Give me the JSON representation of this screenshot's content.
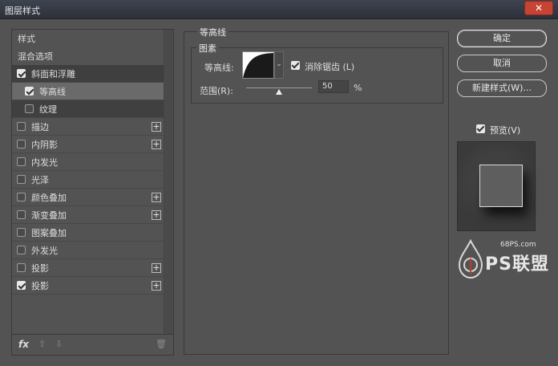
{
  "window": {
    "title": "图层样式",
    "close_glyph": "✕"
  },
  "styles_list": {
    "items": [
      {
        "label": "样式",
        "checkbox": false,
        "checked": false,
        "plus": false
      },
      {
        "label": "混合选项",
        "checkbox": false,
        "checked": false,
        "plus": false
      },
      {
        "label": "斜面和浮雕",
        "checkbox": true,
        "checked": true,
        "plus": false
      },
      {
        "label": "等高线",
        "checkbox": true,
        "checked": true,
        "plus": false
      },
      {
        "label": "纹理",
        "checkbox": true,
        "checked": false,
        "plus": false
      },
      {
        "label": "描边",
        "checkbox": true,
        "checked": false,
        "plus": true
      },
      {
        "label": "内阴影",
        "checkbox": true,
        "checked": false,
        "plus": true
      },
      {
        "label": "内发光",
        "checkbox": true,
        "checked": false,
        "plus": false
      },
      {
        "label": "光泽",
        "checkbox": true,
        "checked": false,
        "plus": false
      },
      {
        "label": "颜色叠加",
        "checkbox": true,
        "checked": false,
        "plus": true
      },
      {
        "label": "渐变叠加",
        "checkbox": true,
        "checked": false,
        "plus": true
      },
      {
        "label": "图案叠加",
        "checkbox": true,
        "checked": false,
        "plus": false
      },
      {
        "label": "外发光",
        "checkbox": true,
        "checked": false,
        "plus": false
      },
      {
        "label": "投影",
        "checkbox": true,
        "checked": false,
        "plus": true
      },
      {
        "label": "投影",
        "checkbox": true,
        "checked": true,
        "plus": true
      }
    ],
    "plus_glyph": "+",
    "footer": {
      "fx": "fx",
      "up_icon": "⇧",
      "down_icon": "⇩",
      "trash_icon": "🗑"
    }
  },
  "contour_panel": {
    "group_title": "等高线",
    "sub_title": "图素",
    "contour_label": "等高线:",
    "dropdown_glyph": "⌄",
    "antialias_label": "消除锯齿 (L)",
    "antialias_checked": true,
    "range_label": "范围(R):",
    "range_value": "50",
    "range_percent": 50,
    "range_unit": "%"
  },
  "actions": {
    "ok": "确定",
    "cancel": "取消",
    "new_style": "新建样式(W)...",
    "preview_label": "预览(V)",
    "preview_checked": true
  },
  "watermark": {
    "site": "68PS.com",
    "brand": "PS联盟"
  }
}
